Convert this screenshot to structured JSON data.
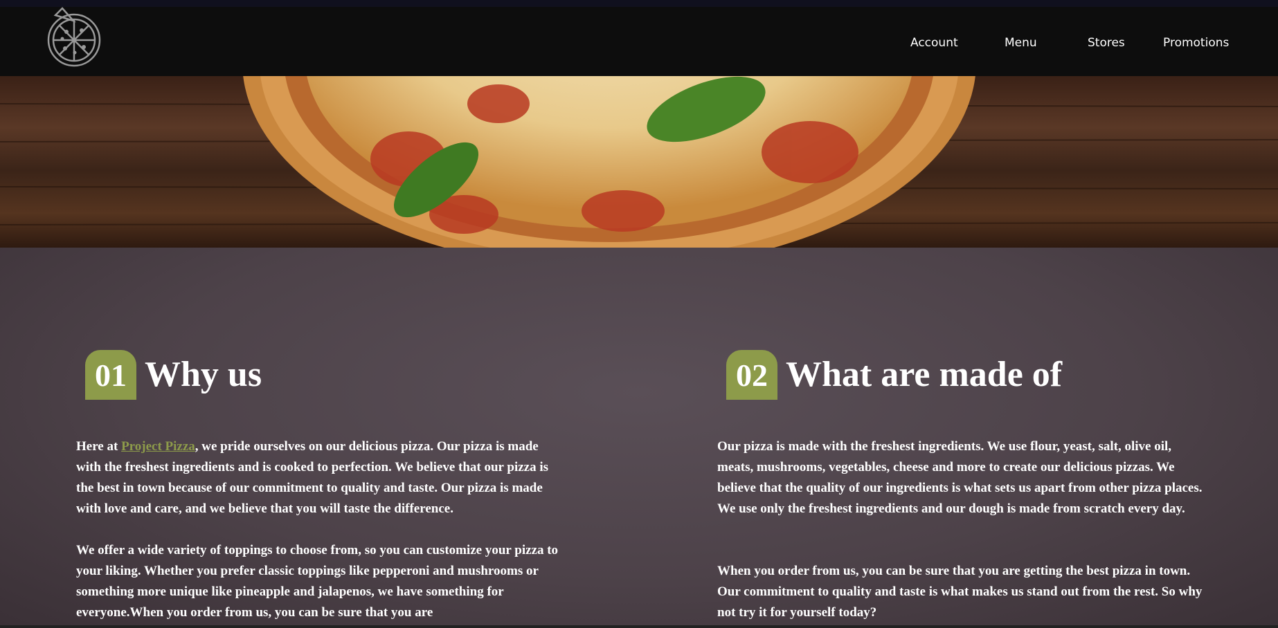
{
  "brand": {
    "logo": "pizza-logo-icon"
  },
  "nav": {
    "items": [
      "Account",
      "Menu",
      "Stores",
      "Promotions"
    ]
  },
  "hero": {
    "image": "pizza-hero-image"
  },
  "colors": {
    "accent": "#8d9b4a",
    "navbar": "#0d0d0d",
    "content_bg": "#4d4249"
  },
  "sections": [
    {
      "number": "01",
      "title": "Why us",
      "p1_before": "Here at ",
      "p1_link": "Project Pizza",
      "p1_after": ", we pride ourselves on our delicious pizza. Our pizza is made with the freshest ingredients and is cooked to perfection. We believe that our pizza is the best in town because of our commitment to quality and taste. Our pizza is made with love and care, and we believe that you will taste the difference.",
      "p2": "We offer a wide variety of toppings to choose from, so you can customize your pizza to your liking. Whether you prefer classic toppings like pepperoni and mushrooms or something more unique like pineapple and jalapenos, we have something for everyone.When you order from us, you can be sure that you are"
    },
    {
      "number": "02",
      "title": "What are made of",
      "p1": "Our pizza is made with the freshest ingredients. We use flour, yeast, salt, olive oil, meats, mushrooms, vegetables, cheese and more to create our delicious pizzas. We believe that the quality of our ingredients is what sets us apart from other pizza places. We use only the freshest ingredients and our dough is made from scratch every day.",
      "p2": "When you order from us, you can be sure that you are getting the best pizza in town. Our commitment to quality and taste is what makes us stand out from the rest. So why not try it for yourself today?"
    }
  ]
}
